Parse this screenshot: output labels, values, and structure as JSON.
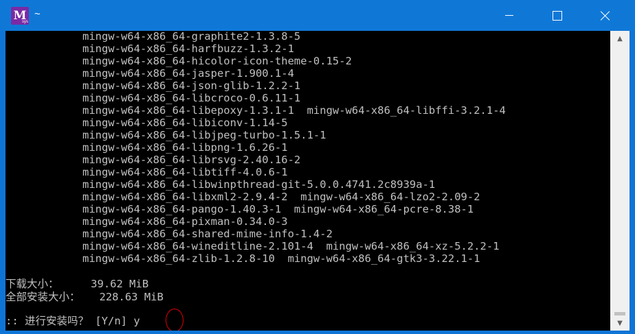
{
  "window": {
    "title": "~",
    "icon_name": "msys2-icon",
    "icon_text": "M",
    "icon_subtext": "sys",
    "minimize_icon": "minimize-icon",
    "maximize_icon": "maximize-icon",
    "close_icon": "close-icon",
    "titlebar_color": "#0f78d7"
  },
  "terminal": {
    "text_color": "#c0c0c0",
    "background": "#000000",
    "package_lines": [
      "            mingw-w64-x86_64-graphite2-1.3.8-5",
      "            mingw-w64-x86_64-harfbuzz-1.3.2-1",
      "            mingw-w64-x86_64-hicolor-icon-theme-0.15-2",
      "            mingw-w64-x86_64-jasper-1.900.1-4",
      "            mingw-w64-x86_64-json-glib-1.2.2-1",
      "            mingw-w64-x86_64-libcroco-0.6.11-1",
      "            mingw-w64-x86_64-libepoxy-1.3.1-1  mingw-w64-x86_64-libffi-3.2.1-4",
      "            mingw-w64-x86_64-libiconv-1.14-5",
      "            mingw-w64-x86_64-libjpeg-turbo-1.5.1-1",
      "            mingw-w64-x86_64-libpng-1.6.26-1",
      "            mingw-w64-x86_64-librsvg-2.40.16-2",
      "            mingw-w64-x86_64-libtiff-4.0.6-1",
      "            mingw-w64-x86_64-libwinpthread-git-5.0.0.4741.2c8939a-1",
      "            mingw-w64-x86_64-libxml2-2.9.4-2  mingw-w64-x86_64-lzo2-2.09-2",
      "            mingw-w64-x86_64-pango-1.40.3-1  mingw-w64-x86_64-pcre-8.38-1",
      "            mingw-w64-x86_64-pixman-0.34.0-3",
      "            mingw-w64-x86_64-shared-mime-info-1.4-2",
      "            mingw-w64-x86_64-wineditline-2.101-4  mingw-w64-x86_64-xz-5.2.2-1",
      "            mingw-w64-x86_64-zlib-1.2.8-10  mingw-w64-x86_64-gtk3-3.22.1-1"
    ],
    "download_size_label": "下载大小：     39.62 MiB",
    "install_size_label": "全部安装大小：   228.63 MiB",
    "prompt_text": ":: 进行安装吗？ [Y/n] ",
    "answer_text": "y",
    "highlight_color": "#e00000"
  },
  "scrollbar": {
    "up_icon": "scroll-up-arrow-icon",
    "down_icon": "scroll-down-arrow-icon",
    "up_glyph": "▲",
    "down_glyph": "▼"
  }
}
